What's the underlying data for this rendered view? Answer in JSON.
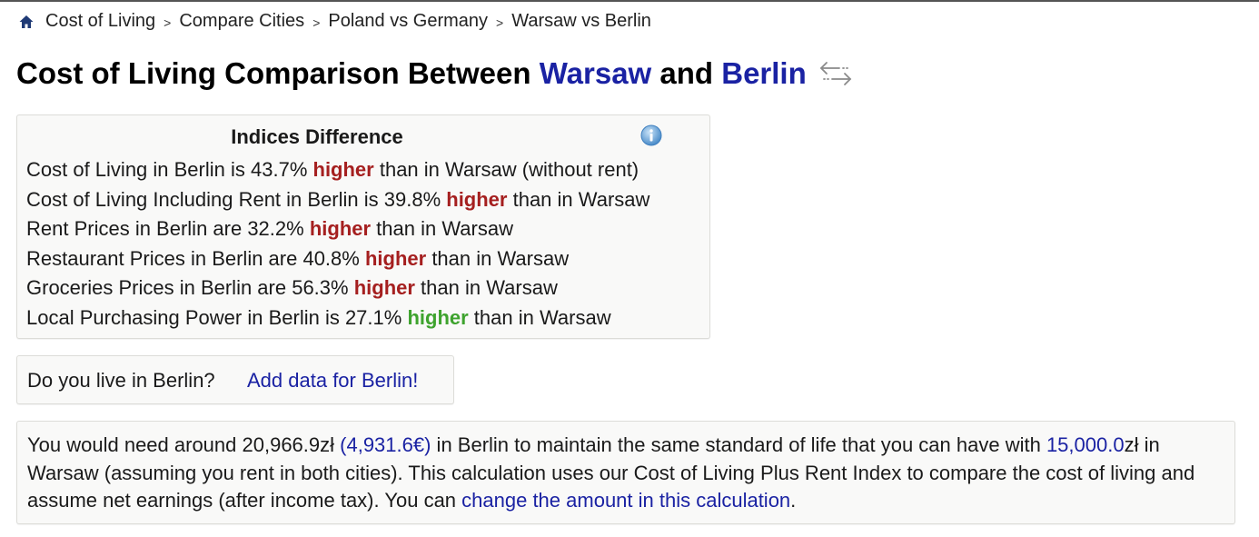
{
  "breadcrumb": {
    "home_icon": "home-icon",
    "items": [
      "Cost of Living",
      "Compare Cities",
      "Poland vs Germany",
      "Warsaw vs Berlin"
    ],
    "separator": ">"
  },
  "title": {
    "prefix": "Cost of Living Comparison Between ",
    "city1": "Warsaw",
    "middle": " and ",
    "city2": "Berlin",
    "swap_icon": "swap-arrows-icon"
  },
  "indices": {
    "heading": "Indices Difference",
    "info_icon": "info-icon",
    "rows": [
      {
        "before": "Cost of Living in Berlin is 43.7% ",
        "highlight": "higher",
        "after": " than in Warsaw (without rent)",
        "color": "red"
      },
      {
        "before": "Cost of Living Including Rent in Berlin is 39.8% ",
        "highlight": "higher",
        "after": " than in Warsaw",
        "color": "red"
      },
      {
        "before": "Rent Prices in Berlin are 32.2% ",
        "highlight": "higher",
        "after": " than in Warsaw",
        "color": "red"
      },
      {
        "before": "Restaurant Prices in Berlin are 40.8% ",
        "highlight": "higher",
        "after": " than in Warsaw",
        "color": "red"
      },
      {
        "before": "Groceries Prices in Berlin are 56.3% ",
        "highlight": "higher",
        "after": " than in Warsaw",
        "color": "red"
      },
      {
        "before": "Local Purchasing Power in Berlin is 27.1% ",
        "highlight": "higher",
        "after": " than in Warsaw",
        "color": "green"
      }
    ],
    "colors": {
      "red": "#a51f1f",
      "green": "#3ea32e"
    }
  },
  "live": {
    "question": "Do you live in Berlin?",
    "link": "Add data for Berlin!"
  },
  "calculation": {
    "t1": "You would need around 20,966.9zł ",
    "eur_link": "(4,931.6€)",
    "t2": " in Berlin to maintain the same standard of life that you can have with ",
    "amount_link": "15,000.0",
    "t3": "zł in Warsaw (assuming you rent in both cities). This calculation uses our Cost of Living Plus Rent Index to compare the cost of living and assume net earnings (after income tax). You can ",
    "change_link": "change the amount in this calculation",
    "t4": "."
  },
  "colors": {
    "link": "#1a22a3",
    "home_icon": "#1f3a75"
  }
}
